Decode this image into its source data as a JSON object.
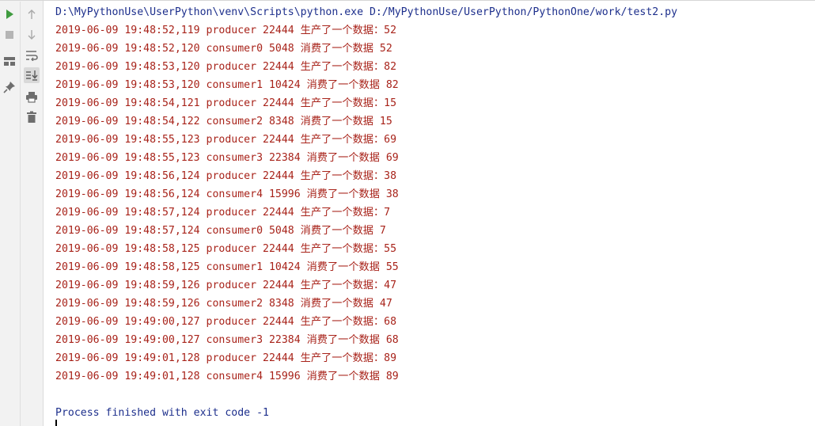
{
  "toolbar": {
    "icons": [
      {
        "name": "run-icon",
        "color": "#3f9b3f"
      },
      {
        "name": "stop-icon",
        "color": "#9a9a9a"
      },
      {
        "name": "layout-icon",
        "color": "#6e6e6e"
      },
      {
        "name": "pin-icon",
        "color": "#6e6e6e"
      },
      {
        "name": "up-arrow-icon",
        "color": "#a0a0a0"
      },
      {
        "name": "down-arrow-icon",
        "color": "#a0a0a0"
      },
      {
        "name": "soft-wrap-icon",
        "color": "#6e6e6e"
      },
      {
        "name": "scroll-to-end-icon",
        "color": "#6e6e6e"
      },
      {
        "name": "print-icon",
        "color": "#6e6e6e"
      },
      {
        "name": "trash-icon",
        "color": "#6e6e6e"
      }
    ]
  },
  "console": {
    "command": "D:\\MyPythonUse\\UserPython\\venv\\Scripts\\python.exe D:/MyPythonUse/UserPython/PythonOne/work/test2.py",
    "lines": [
      "2019-06-09 19:48:52,119 producer 22444 生产了一个数据：52",
      "2019-06-09 19:48:52,120 consumer0 5048 消费了一个数据 52",
      "2019-06-09 19:48:53,120 producer 22444 生产了一个数据：82",
      "2019-06-09 19:48:53,120 consumer1 10424 消费了一个数据 82",
      "2019-06-09 19:48:54,121 producer 22444 生产了一个数据：15",
      "2019-06-09 19:48:54,122 consumer2 8348 消费了一个数据 15",
      "2019-06-09 19:48:55,123 producer 22444 生产了一个数据：69",
      "2019-06-09 19:48:55,123 consumer3 22384 消费了一个数据 69",
      "2019-06-09 19:48:56,124 producer 22444 生产了一个数据：38",
      "2019-06-09 19:48:56,124 consumer4 15996 消费了一个数据 38",
      "2019-06-09 19:48:57,124 producer 22444 生产了一个数据：7",
      "2019-06-09 19:48:57,124 consumer0 5048 消费了一个数据 7",
      "2019-06-09 19:48:58,125 producer 22444 生产了一个数据：55",
      "2019-06-09 19:48:58,125 consumer1 10424 消费了一个数据 55",
      "2019-06-09 19:48:59,126 producer 22444 生产了一个数据：47",
      "2019-06-09 19:48:59,126 consumer2 8348 消费了一个数据 47",
      "2019-06-09 19:49:00,127 producer 22444 生产了一个数据：68",
      "2019-06-09 19:49:00,127 consumer3 22384 消费了一个数据 68",
      "2019-06-09 19:49:01,128 producer 22444 生产了一个数据：89",
      "2019-06-09 19:49:01,128 consumer4 15996 消费了一个数据 89"
    ],
    "exit_message": "Process finished with exit code -1",
    "colors": {
      "command": "#1d2f8c",
      "stderr": "#a8231a",
      "exit": "#1d2f8c"
    }
  }
}
